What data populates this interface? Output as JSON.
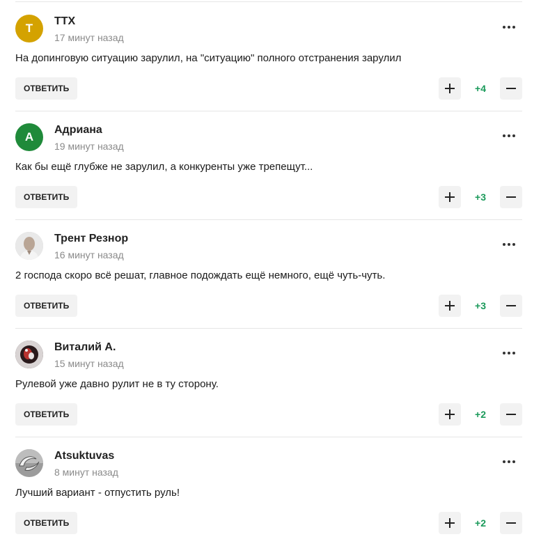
{
  "colors": {
    "score_positive": "#1a9a5a",
    "divider": "#e6e6e6",
    "button_bg": "#f2f2f2"
  },
  "comments": [
    {
      "author": "TTX",
      "time": "17 минут назад",
      "text": "На допинговую ситуацию зарулил, на \"ситуацию\" полного отстранения зарулил",
      "reply_label": "ОТВЕТИТЬ",
      "score": "+4",
      "avatar": {
        "type": "letter",
        "letter": "T",
        "color": "#d4a200"
      }
    },
    {
      "author": "Адриана",
      "time": "19 минут назад",
      "text": "Как бы ещё глубже не зарулил, а конкуренты уже трепещут...",
      "reply_label": "ОТВЕТИТЬ",
      "score": "+3",
      "avatar": {
        "type": "letter",
        "letter": "А",
        "color": "#1f8a3a"
      }
    },
    {
      "author": "Трент Резнор",
      "time": "16 минут назад",
      "text": "2 господа скоро всё решат, главное подождать ещё немного, ещё чуть-чуть.",
      "reply_label": "ОТВЕТИТЬ",
      "score": "+3",
      "avatar": {
        "type": "photo",
        "icon": "portrait-photo"
      }
    },
    {
      "author": "Виталий А.",
      "time": "15 минут назад",
      "text": "Рулевой уже давно рулит не в ту сторону.",
      "reply_label": "ОТВЕТИТЬ",
      "score": "+2",
      "avatar": {
        "type": "photo",
        "icon": "dark-photo"
      }
    },
    {
      "author": "Atsuktuvas",
      "time": "8 минут назад",
      "text": "Лучший вариант - отпустить руль!",
      "reply_label": "ОТВЕТИТЬ",
      "score": "+2",
      "avatar": {
        "type": "photo",
        "icon": "logo-photo"
      }
    }
  ]
}
